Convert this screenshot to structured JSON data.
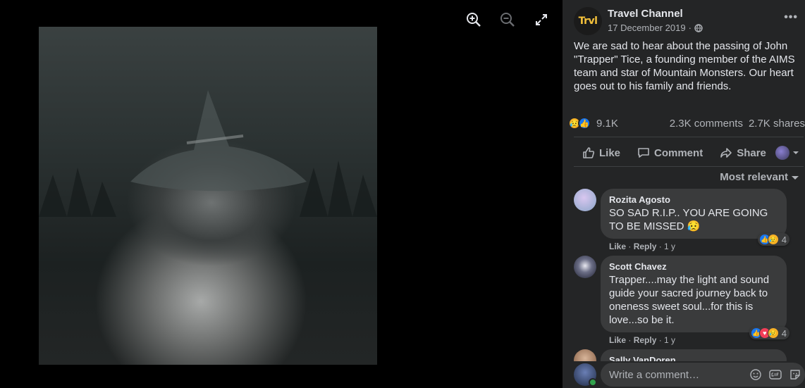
{
  "page": {
    "name": "Travel Channel",
    "avatar_text": "Trvl",
    "date": "17 December 2019",
    "privacy_icon": "globe-icon",
    "post_text": "We are sad to hear about the passing of John \"Trapper\" Tice, a founding member of the AIMS team and star of Mountain Monsters. Our heart goes out to his family and friends."
  },
  "viewer": {
    "tools": [
      "zoom-in-icon",
      "zoom-out-icon",
      "fullscreen-icon"
    ]
  },
  "stats": {
    "reactions": "9.1K",
    "comments": "2.3K comments",
    "shares": "2.7K shares"
  },
  "actions": {
    "like": "Like",
    "comment": "Comment",
    "share": "Share"
  },
  "sort_label": "Most relevant",
  "comments": [
    {
      "author": "Rozita Agosto",
      "text": "SO SAD R.I.P.. YOU ARE GOING TO BE MISSED 😥",
      "reaction_count": "4",
      "like": "Like",
      "reply": "Reply",
      "time": "1 y"
    },
    {
      "author": "Scott Chavez",
      "text": "Trapper....may the light and sound guide your sacred journey back to oneness sweet soul...for this is love...so be it.",
      "reaction_count": "4",
      "like": "Like",
      "reply": "Reply",
      "time": "1 y"
    },
    {
      "author": "Sally VanDoren"
    }
  ],
  "composer": {
    "placeholder": "Write a comment…"
  },
  "colors": {
    "sidebar_bg": "#242526",
    "bubble_bg": "#3a3b3c",
    "text_primary": "#e4e6eb",
    "text_secondary": "#b0b3b8",
    "like_blue": "#1877f2",
    "brand_gold": "#f5c23b"
  }
}
